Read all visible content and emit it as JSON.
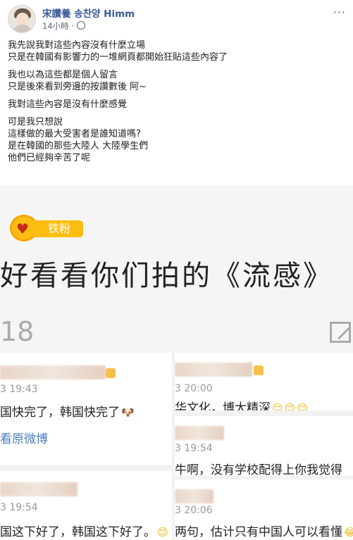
{
  "post": {
    "author": "宋讚養 송찬양 Himm",
    "time": "14小時 ·",
    "more": "···",
    "paragraphs": [
      [
        "我先說我對這些內容沒有什麼立場",
        "只是在韓國有影響力的一堆網頁都開始狂貼這些內容了"
      ],
      [
        "我也以為這些都是個人留言",
        "只是後來看到旁邊的按讚數後 阿~"
      ],
      [
        "我對這些內容是沒有什麼感覺"
      ],
      [
        "可是我只想說",
        "這樣做的最大受害者是誰知道嗎?",
        "是在韓國的那些大陸人 大陸學生們",
        "他們已經夠辛苦了呢"
      ]
    ]
  },
  "image": {
    "badge_label": "铁粉",
    "caption": "好看看你们拍的《流感》",
    "count": "18",
    "comments": [
      {
        "time": "3 19:43",
        "text": "国快完了，韩国快完了",
        "link": "看原微博"
      },
      {
        "time": "3 20:00",
        "text": "华文化，博大精深"
      },
      {
        "time": "3 19:54",
        "text": "牛啊，没有学校配得上你我觉得"
      },
      {
        "time": "3 19:54",
        "text": "国这下好了，韩国这下好了。"
      },
      {
        "time": "3 20:06",
        "text": "两句，估计只有中国人可以看懂"
      }
    ]
  },
  "icons": {
    "fan_heart": "♥",
    "smile": "😊",
    "doge": "🐶",
    "laugh": "😂"
  },
  "colors": {
    "author_link": "#385898",
    "fan_badge": "#fbbd10",
    "weibo_link": "#4d7cbf"
  }
}
